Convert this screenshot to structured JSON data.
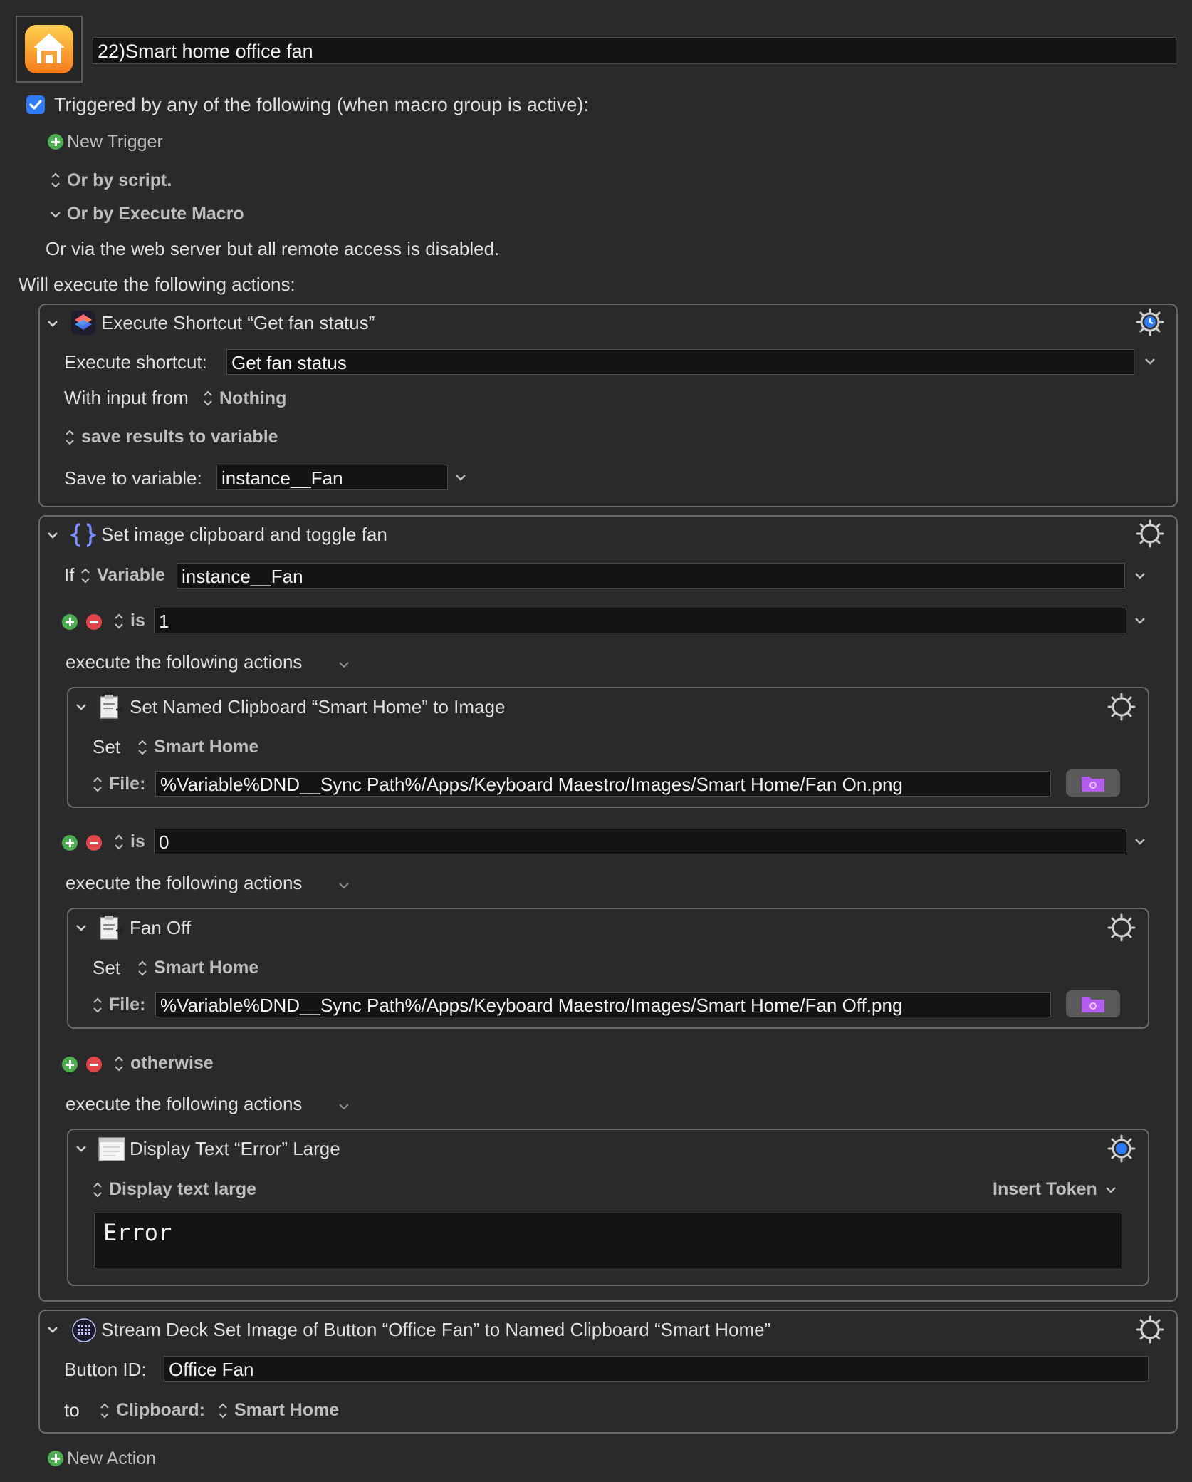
{
  "macro": {
    "name": "22)Smart home office fan",
    "triggered_label": "Triggered by any of the following (when macro group is active):",
    "new_trigger": "New Trigger",
    "or_by_script": "Or by script.",
    "or_by_execute_macro": "Or by Execute Macro",
    "web_server_note": "Or via the web server but all remote access is disabled.",
    "will_execute": "Will execute the following actions:",
    "new_action": "New Action"
  },
  "action1": {
    "title": "Execute Shortcut “Get fan status”",
    "execute_shortcut_label": "Execute shortcut:",
    "shortcut_value": "Get fan status",
    "with_input_label": "With input from",
    "with_input_value": "Nothing",
    "save_results": "save results to variable",
    "save_var_label": "Save to variable:",
    "save_var_value": "instance__Fan"
  },
  "action2": {
    "title": "Set image clipboard and toggle fan",
    "if_label": "If",
    "if_type": "Variable",
    "if_value": "instance__Fan",
    "case1_op": "is",
    "case1_value": "1",
    "exec_following": "execute the following actions",
    "case2_op": "is",
    "case2_value": "0",
    "otherwise": "otherwise",
    "sub1": {
      "title": "Set Named Clipboard “Smart Home” to Image",
      "set_label": "Set",
      "clipboard": "Smart Home",
      "file_label": "File:",
      "file_value": "%Variable%DND__Sync Path%/Apps/Keyboard Maestro/Images/Smart Home/Fan On.png"
    },
    "sub2": {
      "title": "Fan Off",
      "set_label": "Set",
      "clipboard": "Smart Home",
      "file_label": "File:",
      "file_value": "%Variable%DND__Sync Path%/Apps/Keyboard Maestro/Images/Smart Home/Fan Off.png"
    },
    "sub3": {
      "title": "Display Text “Error” Large",
      "mode": "Display text large",
      "insert_token": "Insert Token",
      "text": "Error"
    }
  },
  "action3": {
    "title": "Stream Deck Set Image of Button “Office Fan” to Named Clipboard “Smart Home”",
    "button_id_label": "Button ID:",
    "button_id_value": "Office Fan",
    "to_label": "to",
    "clipboard_label": "Clipboard:",
    "clipboard_value": "Smart Home"
  },
  "colors": {
    "accent_blue": "#2f7bf6",
    "plus_green": "#4cae4f",
    "minus_red": "#e3454b",
    "folder_purple": "#b55cf0"
  }
}
